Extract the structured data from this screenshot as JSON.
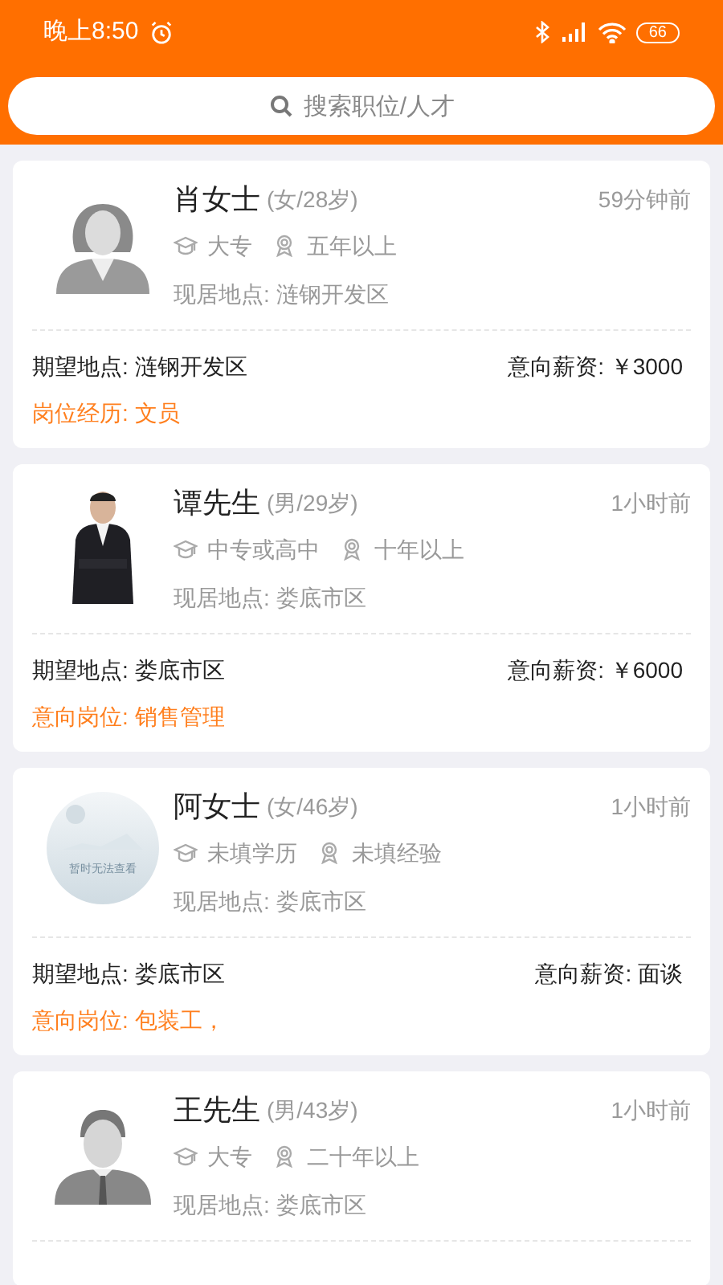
{
  "status_bar": {
    "time": "晚上8:50",
    "battery": "66"
  },
  "search": {
    "placeholder": "搜索职位/人才"
  },
  "candidates": [
    {
      "avatar": {
        "kind": "female"
      },
      "name": "肖女士",
      "info": "(女/28岁)",
      "time": "59分钟前",
      "education": "大专",
      "experience": "五年以上",
      "current_location": "现居地点: 涟钢开发区",
      "expected_location": "期望地点: 涟钢开发区",
      "salary": "意向薪资: ￥3000",
      "position": "岗位经历: 文员"
    },
    {
      "avatar": {
        "kind": "photo"
      },
      "name": "谭先生",
      "info": "(男/29岁)",
      "time": "1小时前",
      "education": "中专或高中",
      "experience": "十年以上",
      "current_location": "现居地点: 娄底市区",
      "expected_location": "期望地点: 娄底市区",
      "salary": "意向薪资: ￥6000",
      "position": "意向岗位: 销售管理"
    },
    {
      "avatar": {
        "kind": "placeholder",
        "label": "暂时无法查看"
      },
      "name": "阿女士",
      "info": "(女/46岁)",
      "time": "1小时前",
      "education": "未填学历",
      "experience": "未填经验",
      "current_location": "现居地点: 娄底市区",
      "expected_location": "期望地点: 娄底市区",
      "salary": "意向薪资: 面谈",
      "position": "意向岗位: 包装工，"
    },
    {
      "avatar": {
        "kind": "male"
      },
      "name": "王先生",
      "info": "(男/43岁)",
      "time": "1小时前",
      "education": "大专",
      "experience": "二十年以上",
      "current_location": "现居地点: 娄底市区"
    }
  ]
}
